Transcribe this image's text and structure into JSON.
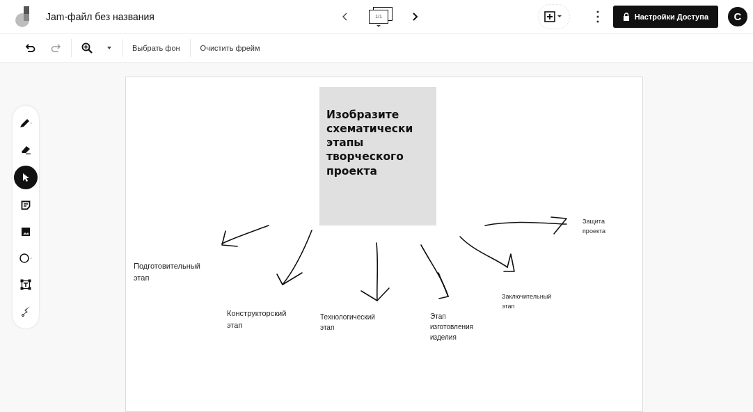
{
  "header": {
    "title": "Jam-файл без названия",
    "frame_counter": "1/1",
    "access_button": "Настройки Доступа",
    "avatar": "С"
  },
  "toolbar": {
    "actions": [
      "Выбрать фон",
      "Очистить фрейм"
    ]
  },
  "tools": [
    {
      "kind": "pen",
      "selected": false
    },
    {
      "kind": "eraser",
      "selected": false
    },
    {
      "kind": "select",
      "selected": true
    },
    {
      "kind": "note",
      "selected": false
    },
    {
      "kind": "image",
      "selected": false
    },
    {
      "kind": "shape",
      "selected": false
    },
    {
      "kind": "textbox",
      "selected": false
    },
    {
      "kind": "laser",
      "selected": false
    }
  ],
  "frame": {
    "sticky_note": "Изобразите схематически этапы творческого проекта",
    "labels": [
      "Подготовительный\nэтап",
      "Конструкторский\nэтап",
      "Технологический\nэтап",
      "Этап\nизготовления\nизделия",
      "Заключительный\nэтап",
      "Защита\nпроекта"
    ]
  }
}
